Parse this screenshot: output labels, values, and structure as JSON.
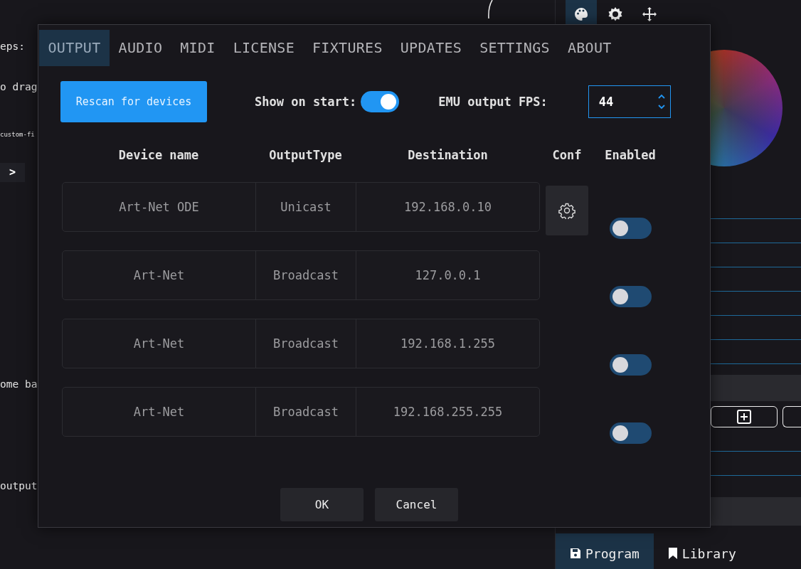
{
  "background": {
    "left_texts": [
      {
        "kind": "label",
        "text": "eps:"
      },
      {
        "kind": "label",
        "text": "o drag"
      },
      {
        "kind": "small",
        "text": "custom-fi"
      },
      {
        "kind": "chevron",
        "text": ">"
      },
      {
        "kind": "label",
        "text": "ome ba"
      },
      {
        "kind": "label",
        "text": "output"
      }
    ],
    "tools": [
      {
        "kind": "palette",
        "selected": true
      },
      {
        "kind": "gear",
        "selected": false
      },
      {
        "kind": "move",
        "selected": false
      }
    ],
    "bottom_tabs": [
      {
        "label": "Program",
        "kind": "save",
        "selected": true
      },
      {
        "label": "Library",
        "kind": "bookmark",
        "selected": false
      }
    ]
  },
  "dialog": {
    "tabs": [
      {
        "label": "OUTPUT",
        "selected": true
      },
      {
        "label": "AUDIO",
        "selected": false
      },
      {
        "label": "MIDI",
        "selected": false
      },
      {
        "label": "LICENSE",
        "selected": false
      },
      {
        "label": "FIXTURES",
        "selected": false
      },
      {
        "label": "UPDATES",
        "selected": false
      },
      {
        "label": "SETTINGS",
        "selected": false
      },
      {
        "label": "ABOUT",
        "selected": false
      }
    ],
    "rescan_button": "Rescan for devices",
    "show_on_start": {
      "label": "Show on start:",
      "on": true
    },
    "fps": {
      "label": "EMU output FPS:",
      "value": "44"
    },
    "columns": [
      "Device name",
      "OutputType",
      "Destination",
      "Conf",
      "Enabled"
    ],
    "devices": [
      {
        "name": "Art-Net ODE",
        "output_type": "Unicast",
        "destination": "192.168.0.10",
        "conf": true,
        "enabled": false
      },
      {
        "name": "Art-Net",
        "output_type": "Broadcast",
        "destination": "127.0.0.1",
        "conf": false,
        "enabled": false
      },
      {
        "name": "Art-Net",
        "output_type": "Broadcast",
        "destination": "192.168.1.255",
        "conf": false,
        "enabled": false
      },
      {
        "name": "Art-Net",
        "output_type": "Broadcast",
        "destination": "192.168.255.255",
        "conf": false,
        "enabled": false
      }
    ],
    "buttons": [
      "OK",
      "Cancel"
    ]
  }
}
